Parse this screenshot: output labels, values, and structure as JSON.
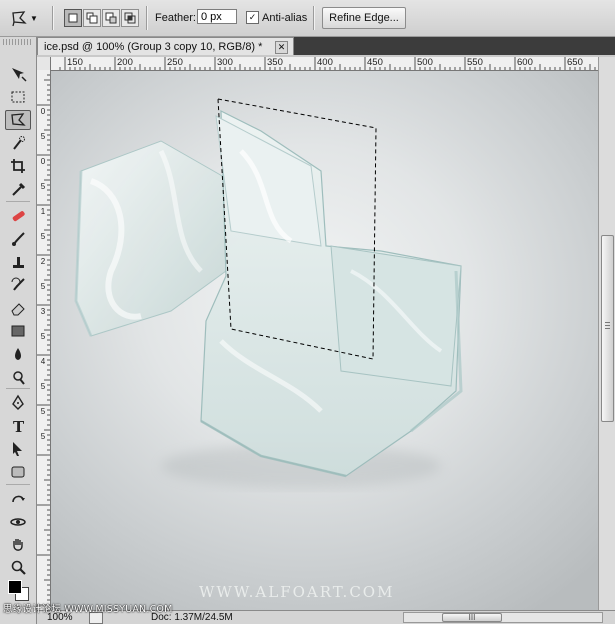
{
  "options_bar": {
    "tool_icon": "polygonal-lasso-icon",
    "selection_modes": [
      "new-selection",
      "add-to-selection",
      "subtract-from-selection",
      "intersect-selection"
    ],
    "feather_label": "Feather:",
    "feather_value": "0 px",
    "antialias_label": "Anti-alias",
    "antialias_checked": true,
    "refine_edge_label": "Refine Edge..."
  },
  "document": {
    "tab_title": "ice.psd @ 100% (Group 3 copy 10, RGB/8) *",
    "close_glyph": "✕"
  },
  "rulers": {
    "horizontal": [
      "150",
      "200",
      "250",
      "300",
      "350",
      "400",
      "450",
      "500",
      "550",
      "600",
      "650"
    ],
    "vertical": [
      "0",
      "5",
      "0",
      "5",
      "1",
      "5",
      "2",
      "5",
      "3",
      "5",
      "4",
      "5",
      "5",
      "5"
    ]
  },
  "toolbar": {
    "tools": [
      "move-icon",
      "marquee-icon",
      "polygonal-lasso-icon",
      "quick-selection-icon",
      "crop-icon",
      "eyedropper-icon",
      "healing-brush-icon",
      "brush-icon",
      "clone-stamp-icon",
      "history-brush-icon",
      "eraser-icon",
      "gradient-icon",
      "blur-icon",
      "dodge-icon",
      "pen-icon",
      "type-icon",
      "path-selection-icon",
      "rectangle-icon",
      "3d-rotate-icon",
      "3d-orbit-icon",
      "hand-icon",
      "zoom-icon"
    ],
    "active_tool": "polygonal-lasso-icon"
  },
  "canvas": {
    "watermark": "WWW.ALFOART.COM"
  },
  "status_bar": {
    "zoom": "100%",
    "doc_size": "Doc: 1.37M/24.5M",
    "scroll_grip": "III"
  },
  "site_watermark": "思缘设计论坛 WWW.MISSYUAN.COM",
  "colors": {
    "panel_bg": "#d7d7d7",
    "canvas_bg": "#c9cdcf",
    "ice": "#dfe8e8",
    "ice_edge": "#9fbfbf",
    "selection": "#000000"
  }
}
